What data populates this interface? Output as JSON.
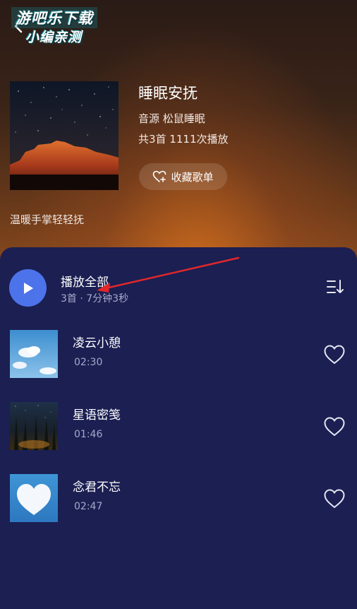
{
  "watermark": {
    "line1": "游吧乐下载",
    "line2": "小编亲测"
  },
  "playlist": {
    "title": "睡眠安抚",
    "source": "音源 松鼠睡眠",
    "stats": "共3首 1111次播放",
    "favorite_label": "收藏歌单",
    "description": "温暖手掌轻轻抚"
  },
  "play_all": {
    "label": "播放全部",
    "meta": "3首 · 7分钟3秒"
  },
  "songs": [
    {
      "title": "凌云小憩",
      "duration": "02:30",
      "thumb": "clouds"
    },
    {
      "title": "星语密笺",
      "duration": "01:46",
      "thumb": "forest-night"
    },
    {
      "title": "念君不忘",
      "duration": "02:47",
      "thumb": "heart-cloud"
    }
  ],
  "colors": {
    "panel": "#1b1f52",
    "play_button": "#4c73ea",
    "annotation_arrow": "#e0282a"
  },
  "icons": [
    "back-chevron-icon",
    "heart-plus-icon",
    "play-icon",
    "sort-icon",
    "heart-outline-icon"
  ]
}
